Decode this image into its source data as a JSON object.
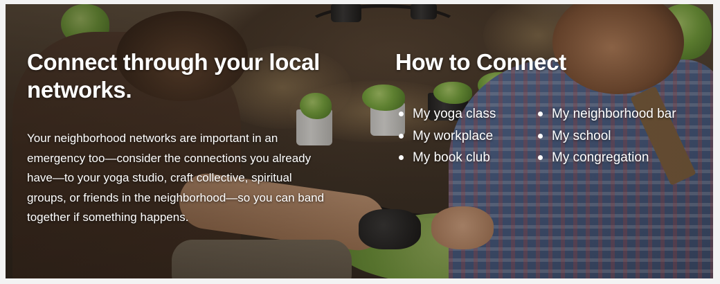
{
  "left": {
    "title": "Connect through your local networks.",
    "body": "Your neighborhood networks are important in an emergency too—consider the connections you already have—to your yoga studio, craft collective, spiritual groups, or friends in the neighborhood—so you can band together if something happens."
  },
  "right": {
    "title": "How to Connect",
    "list_a": [
      "My yoga class",
      "My workplace",
      "My book club"
    ],
    "list_b": [
      "My neighborhood bar",
      "My school",
      "My congregation"
    ]
  },
  "colors": {
    "text": "#ffffff",
    "page_background": "#f3f3f3"
  }
}
